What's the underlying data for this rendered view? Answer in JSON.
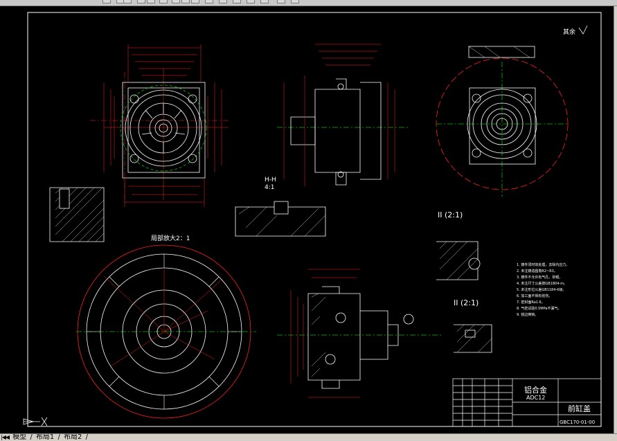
{
  "toolbar": {
    "icons": [
      "layer-icon",
      "open-icon",
      "save-icon",
      "print-icon",
      "cut-icon",
      "copy-icon",
      "paste-icon",
      "undo-icon",
      "redo-icon",
      "pan-icon",
      "zoom-icon",
      "properties-icon",
      "match-icon",
      "text-icon",
      "dim-icon",
      "help-icon"
    ]
  },
  "drawing": {
    "surface_note": "其余",
    "section_hh": "H-H",
    "section_hh_scale": "4:1",
    "detail_ii_top": "II (2:1)",
    "detail_ii_bottom": "II (2:1)",
    "enlarged_label": "局部放大2：1",
    "title_block": {
      "material": "铝合金",
      "material_code": "ADC12",
      "part_name": "前缸盖",
      "drawing_no": "GBC170-01-00"
    },
    "tech_notes": [
      "1. 铸件须时效处理，去除内应力。",
      "2. 未注铸造圆角R2~R3。",
      "3. 铸件不允许有气孔、砂眼。",
      "4. 未注尺寸公差按GB1804-m。",
      "5. 未注形位公差GB1184-K级。",
      "6. 加工面不得有划伤。",
      "7. 密封面Ra1.6。",
      "8. 气密试验0.5MPa不漏气。",
      "9. 锐边倒钝。"
    ]
  },
  "tabs": {
    "model": "模型",
    "layout1": "布局1",
    "layout2": "布局2"
  },
  "colors": {
    "canvas": "#000000",
    "red": "#ff2020",
    "white": "#ffffff",
    "green": "#00c000",
    "yellow": "#ffff00",
    "cyan": "#00ffff"
  }
}
